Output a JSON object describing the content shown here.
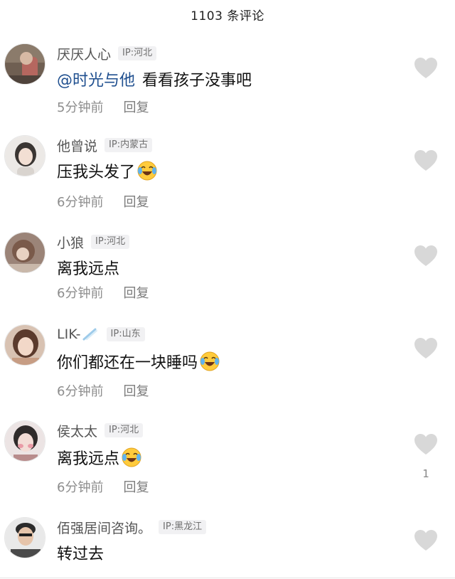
{
  "header": {
    "title": "1103 条评论"
  },
  "comments": [
    {
      "username": "厌厌人心",
      "ip": "IP:河北",
      "mention": "@时光与他",
      "text": "看看孩子没事吧",
      "has_emoji": false,
      "emoji": "",
      "time": "5分钟前",
      "reply": "回复",
      "likes": "",
      "avatar_icon": "avatar-photo",
      "avatar_color": "#8b7b6b"
    },
    {
      "username": "他曾说",
      "ip": "IP:内蒙古",
      "mention": "",
      "text": "压我头发了",
      "has_emoji": true,
      "emoji": "laughing-crying-emoji",
      "time": "6分钟前",
      "reply": "回复",
      "likes": "",
      "avatar_icon": "avatar-photo",
      "avatar_color": "#d9d4cf"
    },
    {
      "username": "小狼",
      "ip": "IP:河北",
      "mention": "",
      "text": "离我远点",
      "has_emoji": false,
      "emoji": "",
      "time": "6分钟前",
      "reply": "回复",
      "likes": "",
      "avatar_icon": "avatar-photo",
      "avatar_color": "#7a5a4a"
    },
    {
      "username": "LIK-",
      "ip": "IP:山东",
      "mention": "",
      "text": "你们都还在一块睡吗",
      "has_emoji": true,
      "emoji": "laughing-crying-emoji",
      "time": "6分钟前",
      "reply": "回复",
      "likes": "",
      "avatar_icon": "avatar-photo",
      "avatar_color": "#c79d84"
    },
    {
      "username": "侯太太",
      "ip": "IP:河北",
      "mention": "",
      "text": "离我远点",
      "has_emoji": true,
      "emoji": "laughing-crying-emoji",
      "time": "6分钟前",
      "reply": "回复",
      "likes": "1",
      "avatar_icon": "avatar-photo",
      "avatar_color": "#b88c8c"
    },
    {
      "username": "佰强居间咨询。",
      "ip": "IP:黑龙江",
      "mention": "",
      "text": "转过去",
      "has_emoji": false,
      "emoji": "",
      "time": "",
      "reply": "",
      "likes": "",
      "avatar_icon": "avatar-photo",
      "avatar_color": "#6d6d6d"
    }
  ],
  "colors": {
    "mention": "#1f4f8f",
    "heart": "#d8d8d8",
    "ip_badge_bg": "#f1f1f3"
  }
}
